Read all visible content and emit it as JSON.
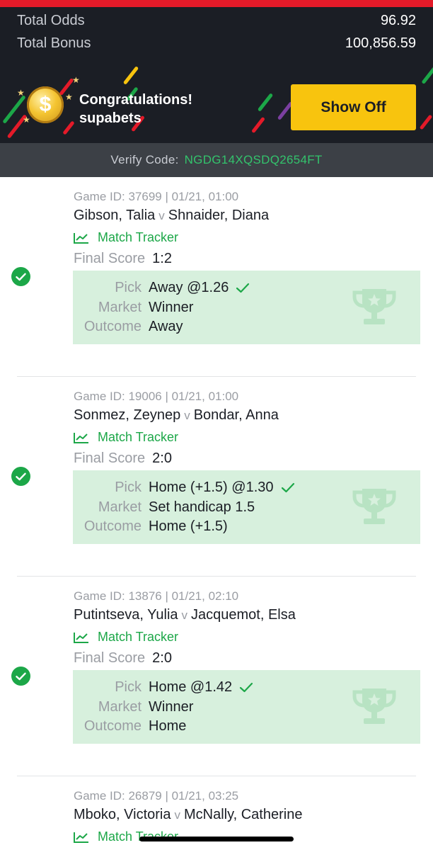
{
  "summary": {
    "total_odds_label": "Total Odds",
    "total_odds_value": "96.92",
    "total_bonus_label": "Total Bonus",
    "total_bonus_value": "100,856.59"
  },
  "banner": {
    "coin_glyph": "$",
    "title": "Congratulations!",
    "username": "supabets",
    "show_off_label": "Show Off"
  },
  "verify": {
    "label": "Verify Code:",
    "code": "NGDG14XQSDQ2654FT"
  },
  "labels": {
    "match_tracker": "Match Tracker",
    "final_score": "Final Score",
    "pick": "Pick",
    "market": "Market",
    "outcome": "Outcome",
    "vs": "v"
  },
  "colors": {
    "accent_green": "#1ca748",
    "verify_code": "#33c36c",
    "show_off_bg": "#f8c40e",
    "panel_bg": "#d7f0dd",
    "header_bg": "#1b1e25",
    "top_strip": "#e41a29"
  },
  "bets": [
    {
      "game_id": "Game ID: 37699 | 01/21, 01:00",
      "home": "Gibson, Talia",
      "away": "Shnaider, Diana",
      "final_score": "1:2",
      "pick": "Away @1.26",
      "market": "Winner",
      "outcome": "Away",
      "status": "won"
    },
    {
      "game_id": "Game ID: 19006 | 01/21, 01:00",
      "home": "Sonmez, Zeynep",
      "away": "Bondar, Anna",
      "final_score": "2:0",
      "pick": "Home (+1.5) @1.30",
      "market": "Set handicap 1.5",
      "outcome": "Home (+1.5)",
      "status": "won"
    },
    {
      "game_id": "Game ID: 13876 | 01/21, 02:10",
      "home": "Putintseva, Yulia",
      "away": "Jacquemot, Elsa",
      "final_score": "2:0",
      "pick": "Home @1.42",
      "market": "Winner",
      "outcome": "Home",
      "status": "won"
    },
    {
      "game_id": "Game ID: 26879 | 01/21, 03:25",
      "home": "Mboko, Victoria",
      "away": "McNally, Catherine"
    }
  ]
}
